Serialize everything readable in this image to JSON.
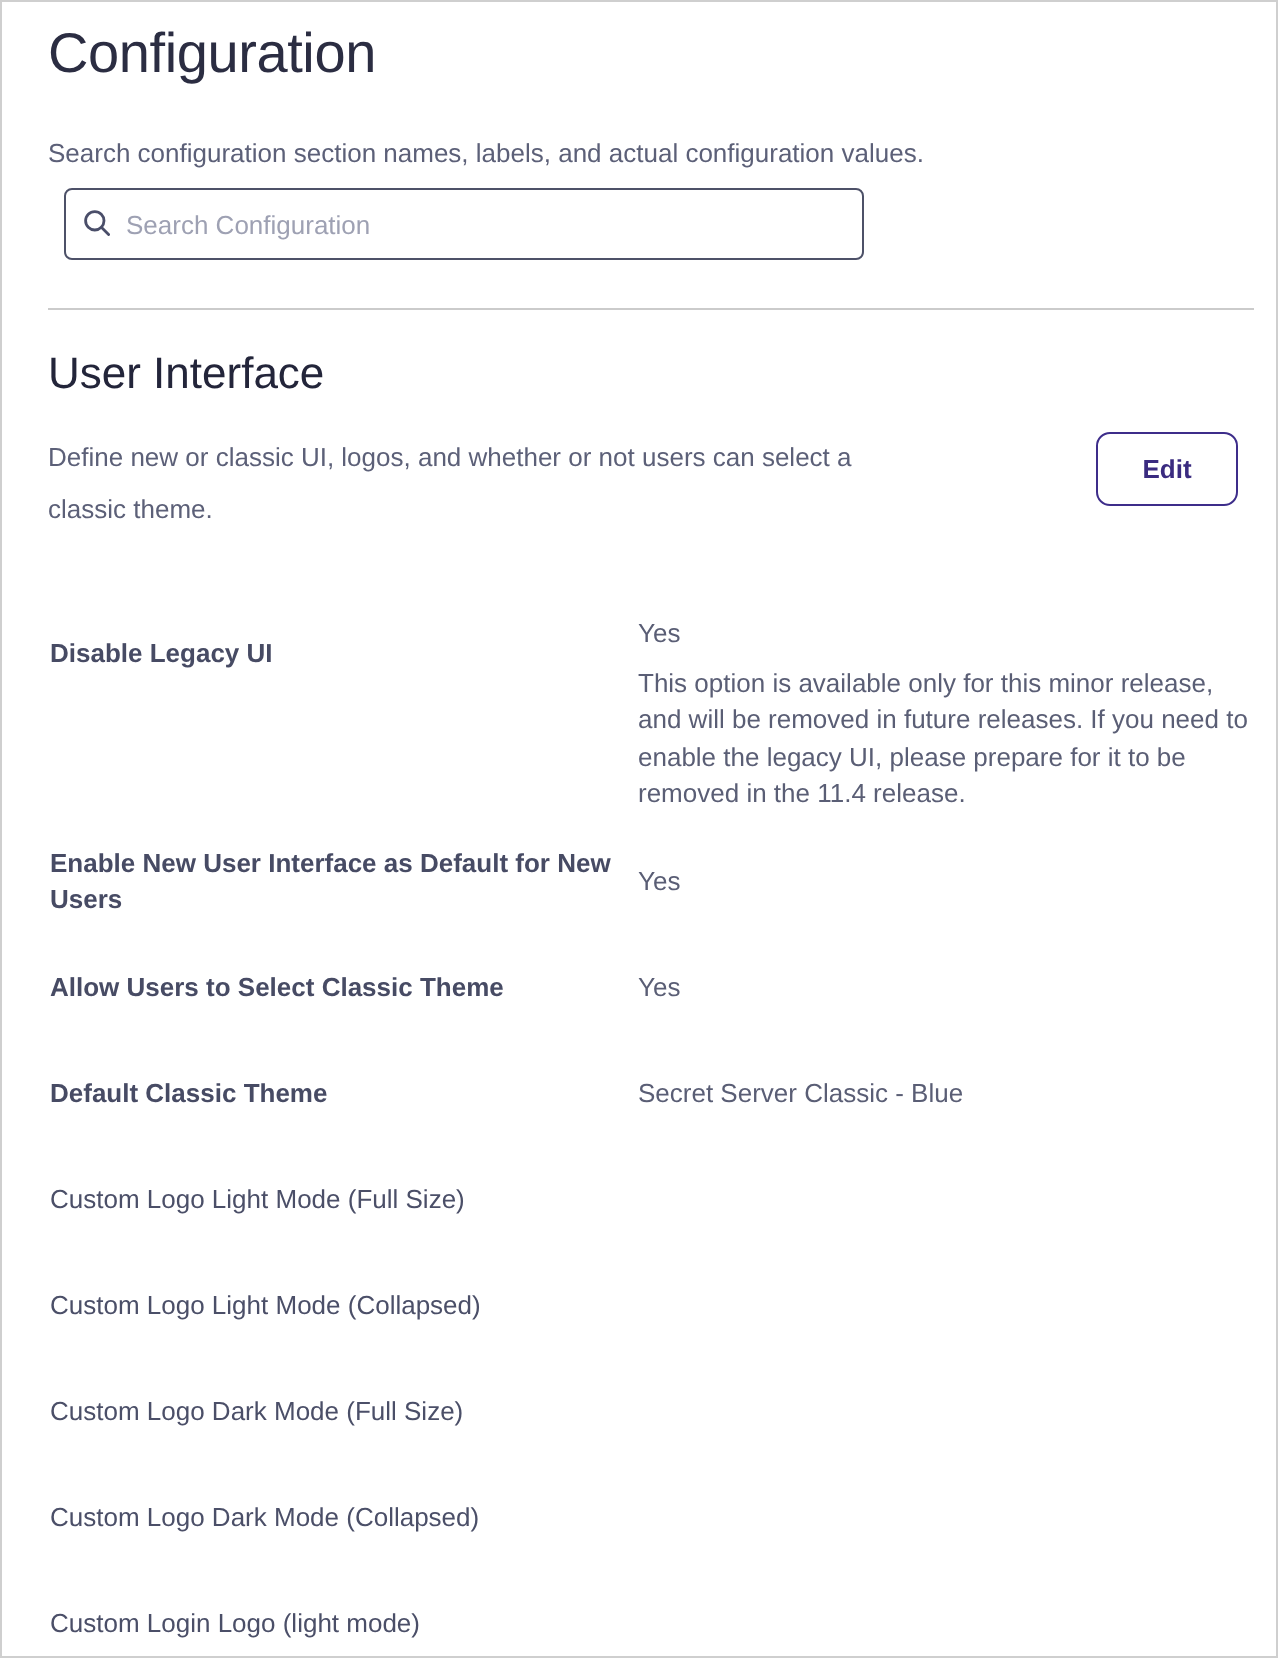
{
  "page": {
    "title": "Configuration",
    "description": "Search configuration section names, labels, and actual configuration values.",
    "search": {
      "placeholder": "Search Configuration"
    }
  },
  "section": {
    "title": "User Interface",
    "description": "Define new or classic UI, logos, and whether or not users can select a classic theme.",
    "button": "Edit"
  },
  "settings": [
    {
      "kind": "value",
      "label": "Disable Legacy UI",
      "value": "Yes",
      "note": "This option is available only for this minor release, and will be removed in future releases. If you need to enable the legacy UI, please prepare for it to be removed in the 11.4 release."
    },
    {
      "kind": "value",
      "label": "Enable New User Interface as Default for New Users",
      "value": "Yes"
    },
    {
      "kind": "value",
      "label": "Allow Users to Select Classic Theme",
      "value": "Yes"
    },
    {
      "kind": "value",
      "label": "Default Classic Theme",
      "value": "Secret Server Classic - Blue"
    },
    {
      "kind": "logo",
      "label": "Custom Logo Light Mode (Full Size)"
    },
    {
      "kind": "logo",
      "label": "Custom Logo Light Mode (Collapsed)"
    },
    {
      "kind": "logo",
      "label": "Custom Logo Dark Mode (Full Size)"
    },
    {
      "kind": "logo",
      "label": "Custom Logo Dark Mode (Collapsed)"
    },
    {
      "kind": "logo",
      "label": "Custom Login Logo (light mode)"
    }
  ]
}
